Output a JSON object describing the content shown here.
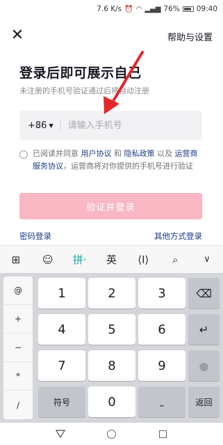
{
  "status_bar": {
    "network_speed": "7.6 K/s",
    "battery": "76%",
    "time": "09:40"
  },
  "header": {
    "close_icon": "close-icon",
    "help_label": "帮助与设置"
  },
  "login": {
    "title": "登录后即可展示自己",
    "subtitle": "未注册的手机号验证通过后将自动注册",
    "country_code": "+86",
    "phone_placeholder": "请输入手机号",
    "agreement_prefix": "已阅读并同意 ",
    "user_agreement": "用户协议",
    "and": " 和 ",
    "privacy_policy": "隐私政策",
    "and_also": " 以及 ",
    "carrier_agreement": "运营商服务协议",
    "agreement_suffix": "，运营商将对你提供的手机号进行验证",
    "submit_label": "验证并登录",
    "password_login": "密码登录",
    "other_login": "其他方式登录"
  },
  "keyboard": {
    "toolbar": [
      {
        "name": "grid-icon",
        "glyph": "⊞"
      },
      {
        "name": "emoji-icon",
        "glyph": "☺"
      },
      {
        "name": "pinyin-mode",
        "glyph": "拼·"
      },
      {
        "name": "english-mode",
        "glyph": "英"
      },
      {
        "name": "cursor-icon",
        "glyph": "⟨I⟩"
      },
      {
        "name": "search-icon",
        "glyph": "⌕"
      },
      {
        "name": "chevron-down-icon",
        "glyph": "∨"
      }
    ],
    "side_keys": [
      "@",
      "+",
      "−",
      "*",
      "/"
    ],
    "digits": [
      "1",
      "2",
      "3",
      "4",
      "5",
      "6",
      "7",
      "8",
      "9",
      "0"
    ],
    "symbols_label": "符号",
    "return_label": "返回",
    "space_glyph": "⎵",
    "backspace_icon": "backspace-icon",
    "enter_icon": "enter-icon",
    "mic_icon": "microphone-icon"
  },
  "colors": {
    "accent_pink": "#f9b7c4",
    "link_blue": "#1f3c8a",
    "arrow_red": "#e5262b"
  }
}
